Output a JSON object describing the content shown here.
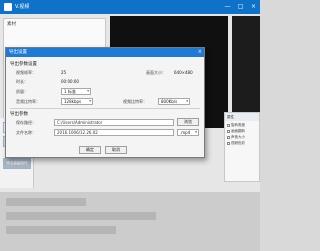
{
  "app": {
    "title": "V.视频",
    "window_buttons": {
      "minimize": "—",
      "maximize": "□",
      "close": "×"
    }
  },
  "left_panel": {
    "label": "素材"
  },
  "side_nav": {
    "items": [
      "添加素材",
      "高级制作应用",
      "完全高级制作"
    ]
  },
  "right_panel": {
    "header": "属性",
    "items": [
      "旋转角度",
      "画面翻转",
      "声音大小",
      "视频色彩"
    ]
  },
  "dialog": {
    "title": "导出设置",
    "close": "×",
    "video_group": {
      "title": "导出参数设置",
      "fps_label": "视频帧率：",
      "fps_value": "25",
      "size_label": "画面大小：",
      "size_value": "640×480",
      "duration_label": "时长：",
      "duration_value": "00:00:00",
      "quality_label": "质量：",
      "quality_value": "1 标准",
      "audio_bitrate_label": "音频比特率：",
      "audio_bitrate_value": "128kbps",
      "video_bitrate_label": "视频比特率：",
      "video_bitrate_value": "800Kb/s"
    },
    "output_group": {
      "title": "导出参数",
      "folder_label": "保存路径：",
      "folder_value": "C:/Users/Administrator",
      "browse": "浏览",
      "filename_label": "文件名称：",
      "filename_value": "2016.1006/12.26.02",
      "format_value": ".mp4"
    },
    "ok": "确定",
    "cancel": "取消"
  }
}
